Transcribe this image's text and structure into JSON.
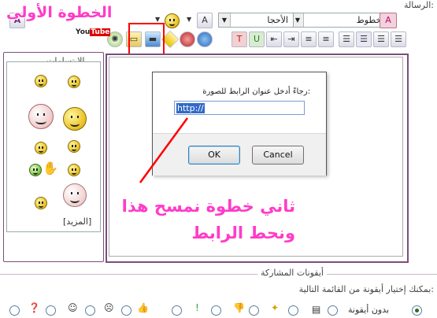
{
  "page": {
    "message_label": "الرسالة:"
  },
  "toolbar": {
    "font_select": "الخطوط",
    "size_select": "الأحجا",
    "size_a": "A",
    "buttons_row1": [
      "clear-format",
      "font-color",
      "smiley",
      "undo",
      "redo",
      "emoticon"
    ],
    "buttons_row2": [
      "align-right",
      "align-center",
      "align-left",
      "justify",
      "ordered-list",
      "unordered-list",
      "indent",
      "outdent",
      "web-link",
      "email-link",
      "insert-image",
      "quote",
      "code",
      "youtube",
      "settings"
    ]
  },
  "smilies": {
    "legend": "الابتسامات",
    "more_link": "[المزيد]"
  },
  "dialog": {
    "prompt": "رجاءً أدخل عنوان الرابط للصورة:",
    "input_value": "http://",
    "ok_label": "OK",
    "cancel_label": "Cancel"
  },
  "annotations": {
    "step_one": "الخطوة الأولى",
    "step_two": "ثاني خطوة نمسح هذا ونحط الرابط"
  },
  "post_icons": {
    "legend": "أيقونات المشاركة",
    "description": "بمكنك إختيار أيقونة من القائمة التالية:",
    "no_icon_label": "بدون أيقونة"
  },
  "colors": {
    "annotation": "#ff3cc8",
    "highlight_box": "#ff0000",
    "editor_border": "#7a4f7a"
  }
}
